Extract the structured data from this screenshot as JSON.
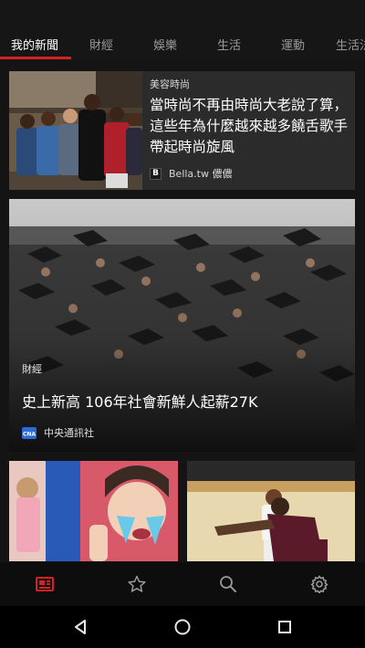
{
  "tabs": [
    {
      "label": "我的新聞",
      "active": true
    },
    {
      "label": "財經",
      "active": false
    },
    {
      "label": "娛樂",
      "active": false
    },
    {
      "label": "生活",
      "active": false
    },
    {
      "label": "運動",
      "active": false
    },
    {
      "label": "生活法",
      "active": false
    }
  ],
  "accent_color": "#d81f26",
  "cards": [
    {
      "category": "美容時尚",
      "title": "當時尚不再由時尚大老說了算，這些年為什麼越來越多饒舌歌手帶起時尚旋風",
      "source_logo": "B",
      "source": "Bella.tw 儂儂"
    },
    {
      "category": "財經",
      "title": "史上新高 106年社會新鮮人起薪27K",
      "source_logo": "CNA",
      "source": "中央通訊社"
    }
  ],
  "bottom_nav": [
    {
      "icon": "news-icon",
      "active": true
    },
    {
      "icon": "star-icon",
      "active": false
    },
    {
      "icon": "search-icon",
      "active": false
    },
    {
      "icon": "gear-icon",
      "active": false
    }
  ],
  "system_nav": [
    {
      "icon": "back-icon"
    },
    {
      "icon": "home-icon"
    },
    {
      "icon": "recents-icon"
    }
  ]
}
